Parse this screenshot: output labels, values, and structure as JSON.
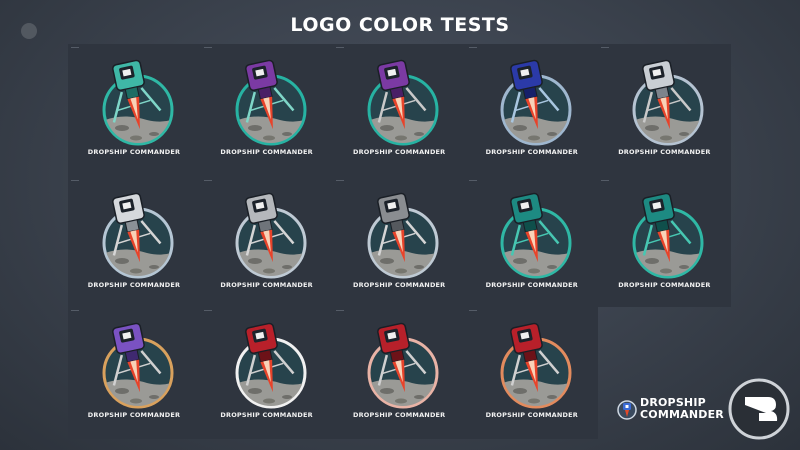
{
  "page": {
    "title": "LOGO COLOR TESTS"
  },
  "tile_label": "DROPSHIP COMMANDER",
  "variants": [
    {
      "body": "#3fb7a6",
      "accent": "#1d6d64",
      "ring": "#2fb8a5",
      "leg": "#7fd6c8"
    },
    {
      "body": "#7b3aa3",
      "accent": "#4a1f66",
      "ring": "#27b3a3",
      "leg": "#7fd6c8"
    },
    {
      "body": "#7b3aa3",
      "accent": "#4a1f66",
      "ring": "#27b3a3",
      "leg": "#c9c9c9"
    },
    {
      "body": "#2b3aa8",
      "accent": "#16206a",
      "ring": "#9fb7cf",
      "leg": "#a9c6e0"
    },
    {
      "body": "#c9ced4",
      "accent": "#7d848c",
      "ring": "#b5c3d2",
      "leg": "#c9c9c9"
    },
    {
      "body": "#d5d8dc",
      "accent": "#8a9096",
      "ring": "#b5c6d4",
      "leg": "#d5d5d5"
    },
    {
      "body": "#b5b8bc",
      "accent": "#6f747a",
      "ring": "#bfcad4",
      "leg": "#d5d5d5"
    },
    {
      "body": "#8a8d91",
      "accent": "#55595e",
      "ring": "#bfcad4",
      "leg": "#d5d5d5"
    },
    {
      "body": "#1d8a82",
      "accent": "#0f4f4b",
      "ring": "#2fb8a5",
      "leg": "#47c7b2"
    },
    {
      "body": "#1d8a82",
      "accent": "#0f4f4b",
      "ring": "#2fb8a5",
      "leg": "#47c7b2"
    },
    {
      "body": "#7a52c2",
      "accent": "#3f2970",
      "ring": "#d9a15d",
      "leg": "#d0d0d0"
    },
    {
      "body": "#b8202a",
      "accent": "#6d1218",
      "ring": "#f1f1f1",
      "leg": "#d0d0d0"
    },
    {
      "body": "#b8202a",
      "accent": "#6d1218",
      "ring": "#e9b3a6",
      "leg": "#d0d0d0"
    },
    {
      "body": "#b8202a",
      "accent": "#6d1218",
      "ring": "#e28b5e",
      "leg": "#d0d0d0"
    }
  ],
  "brand": {
    "line1": "DROPSHIP",
    "line2": "COMMANDER"
  }
}
